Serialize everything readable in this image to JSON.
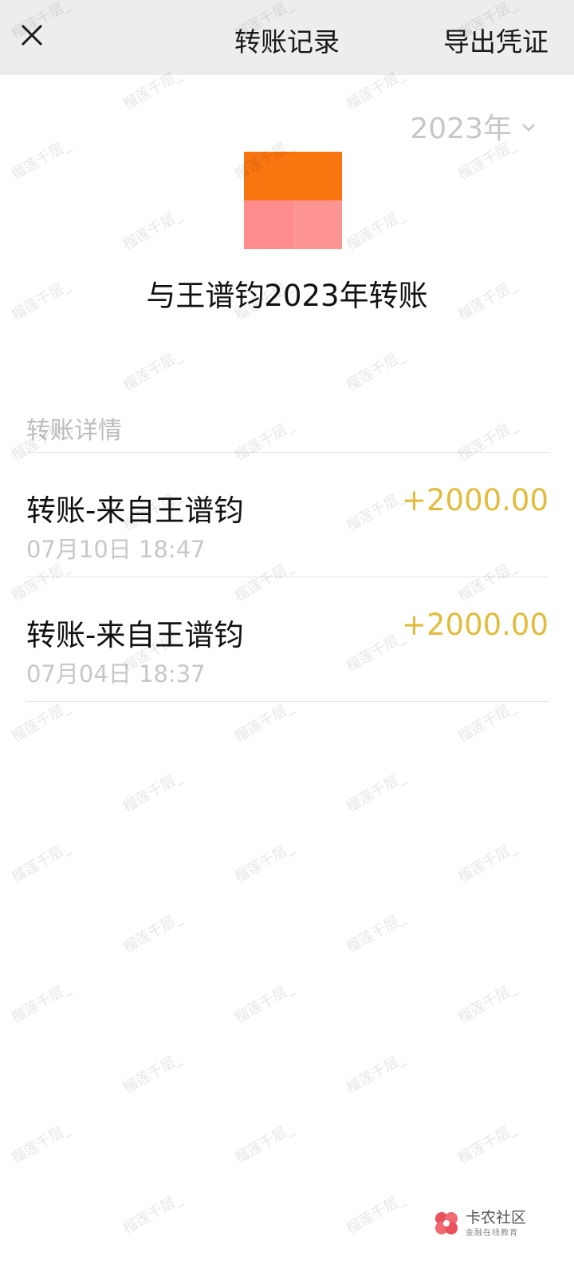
{
  "header": {
    "title": "转账记录",
    "export_label": "导出凭证"
  },
  "year_filter": {
    "value": "2023年"
  },
  "summary": {
    "title": "与王谱钧2023年转账"
  },
  "avatar": {
    "colors": [
      "#f97510",
      "#f97510",
      "#ff8c8c",
      "#ff9494"
    ]
  },
  "section": {
    "label": "转账详情"
  },
  "transactions": [
    {
      "name": "转账-来自王谱钧",
      "time": "07月10日 18:47",
      "amount": "+2000.00"
    },
    {
      "name": "转账-来自王谱钧",
      "time": "07月04日 18:37",
      "amount": "+2000.00"
    }
  ],
  "watermark": {
    "text": "榴莲千层_"
  },
  "logo": {
    "name": "卡农社区",
    "sub": "金融在线教育"
  },
  "colors": {
    "accent_amount": "#e2bc3c",
    "header_bg": "#ededed"
  }
}
